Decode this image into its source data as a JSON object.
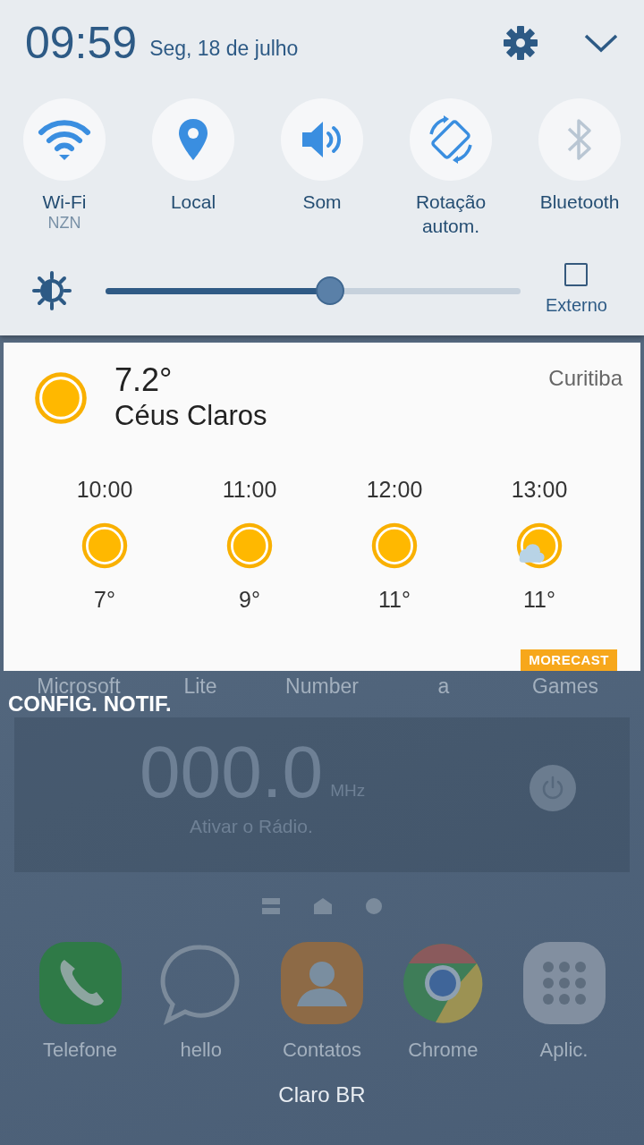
{
  "status_header": {
    "time": "09:59",
    "date": "Seg, 18 de julho"
  },
  "quick_toggles": [
    {
      "kind": "wifi",
      "label": "Wi-Fi",
      "sublabel": "NZN",
      "on": true
    },
    {
      "kind": "location",
      "label": "Local",
      "on": true
    },
    {
      "kind": "sound",
      "label": "Som",
      "on": true
    },
    {
      "kind": "rotation",
      "label": "Rotação autom.",
      "on": true
    },
    {
      "kind": "bluetooth",
      "label": "Bluetooth",
      "on": false
    }
  ],
  "brightness": {
    "level": 0.54,
    "external_label": "Externo",
    "external_checked": false
  },
  "weather": {
    "temperature": "7.2°",
    "condition": "Céus Claros",
    "city": "Curitiba",
    "brand": "MORECAST",
    "forecast": [
      {
        "time": "10:00",
        "kind": "sun",
        "temp": "7°"
      },
      {
        "time": "11:00",
        "kind": "sun",
        "temp": "9°"
      },
      {
        "time": "12:00",
        "kind": "sun",
        "temp": "11°"
      },
      {
        "time": "13:00",
        "kind": "sun-cloud",
        "temp": "11°"
      }
    ]
  },
  "background_app_labels": [
    "Microsoft",
    "Lite",
    "Number",
    "a",
    "Games"
  ],
  "notification_settings": "CONFIG. NOTIF.",
  "radio_widget": {
    "frequency": "000.0",
    "unit": "MHz",
    "hint": "Ativar o Rádio."
  },
  "page_indicators": [
    {
      "kind": "list"
    },
    {
      "kind": "home"
    },
    {
      "kind": "dot"
    }
  ],
  "dock": [
    {
      "kind": "phone",
      "label": "Telefone"
    },
    {
      "kind": "chat",
      "label": "hello"
    },
    {
      "kind": "contacts",
      "label": "Contatos"
    },
    {
      "kind": "chrome",
      "label": "Chrome"
    },
    {
      "kind": "apps",
      "label": "Aplic."
    }
  ],
  "carrier": "Claro BR"
}
